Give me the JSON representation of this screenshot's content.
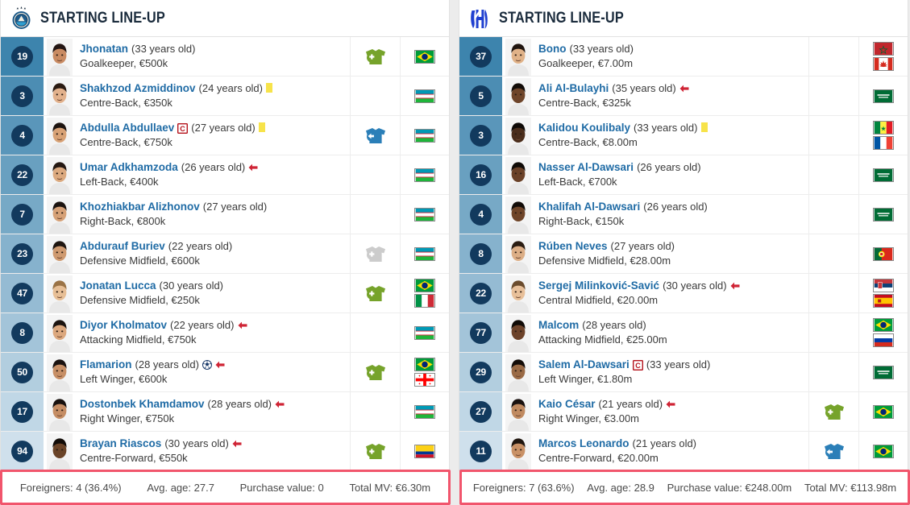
{
  "left": {
    "header": {
      "title": "STARTING LINE-UP",
      "crest_icon": "pakhtakor-crest-icon",
      "crest_colors": {
        "ring": "#1f5c8b",
        "field": "#2f9fd0"
      }
    },
    "players": [
      {
        "number": "19",
        "name": "Jhonatan",
        "age": "(33 years old)",
        "pos_value": "Goalkeeper, €500k",
        "marks": [],
        "sub": "sub-in-green",
        "flags": [
          "brazil"
        ],
        "skin": "#c98b63",
        "hair": "#231512"
      },
      {
        "number": "3",
        "name": "Shakhzod Azmiddinov",
        "age": "(24 years old)",
        "pos_value": "Centre-Back, €350k",
        "marks": [
          "yellow-card"
        ],
        "sub": "",
        "flags": [
          "uzbekistan"
        ],
        "skin": "#e2b18c",
        "hair": "#2a1a12"
      },
      {
        "number": "4",
        "name": "Abdulla Abdullaev",
        "age": "(27 years old)",
        "pos_value": "Centre-Back, €750k",
        "marks": [
          "captain",
          "yellow-card"
        ],
        "sub": "sub-out-blue",
        "flags": [
          "uzbekistan"
        ],
        "skin": "#d8a276",
        "hair": "#1d1410"
      },
      {
        "number": "22",
        "name": "Umar Adkhamzoda",
        "age": "(26 years old)",
        "pos_value": "Left-Back, €400k",
        "marks": [
          "sub-arrow-red"
        ],
        "sub": "",
        "flags": [
          "uzbekistan"
        ],
        "skin": "#dba97f",
        "hair": "#241812"
      },
      {
        "number": "7",
        "name": "Khozhiakbar Alizhonov",
        "age": "(27 years old)",
        "pos_value": "Right-Back, €800k",
        "marks": [],
        "sub": "",
        "flags": [
          "uzbekistan"
        ],
        "skin": "#d6a177",
        "hair": "#1b1310"
      },
      {
        "number": "23",
        "name": "Abdurauf Buriev",
        "age": "(22 years old)",
        "pos_value": "Defensive Midfield, €600k",
        "marks": [],
        "sub": "sub-in-grey",
        "flags": [
          "uzbekistan"
        ],
        "skin": "#cf9a70",
        "hair": "#1e1510"
      },
      {
        "number": "47",
        "name": "Jonatan Lucca",
        "age": "(30 years old)",
        "pos_value": "Defensive Midfield, €250k",
        "marks": [],
        "sub": "sub-in-green",
        "flags": [
          "brazil",
          "italy"
        ],
        "skin": "#e7bf96",
        "hair": "#9a7346"
      },
      {
        "number": "8",
        "name": "Diyor Kholmatov",
        "age": "(22 years old)",
        "pos_value": "Attacking Midfield, €750k",
        "marks": [
          "sub-arrow-red"
        ],
        "sub": "",
        "flags": [
          "uzbekistan"
        ],
        "skin": "#dca87e",
        "hair": "#1c1410"
      },
      {
        "number": "50",
        "name": "Flamarion",
        "age": "(28 years old)",
        "pos_value": "Left Winger, €600k",
        "marks": [
          "goal",
          "sub-arrow-red"
        ],
        "sub": "sub-in-green",
        "flags": [
          "brazil",
          "georgia"
        ],
        "skin": "#c78f66",
        "hair": "#1a1210"
      },
      {
        "number": "17",
        "name": "Dostonbek Khamdamov",
        "age": "(28 years old)",
        "pos_value": "Right Winger, €750k",
        "marks": [
          "sub-arrow-red"
        ],
        "sub": "",
        "flags": [
          "uzbekistan"
        ],
        "skin": "#c58d64",
        "hair": "#18110e"
      },
      {
        "number": "94",
        "name": "Brayan Riascos",
        "age": "(30 years old)",
        "pos_value": "Centre-Forward, €550k",
        "marks": [
          "sub-arrow-red"
        ],
        "sub": "sub-in-green",
        "flags": [
          "colombia"
        ],
        "skin": "#6b4428",
        "hair": "#120c08"
      }
    ],
    "footer": {
      "foreigners": "Foreigners: 4 (36.4%)",
      "avg_age": "Avg. age: 27.7",
      "purchase_value": "Purchase value: 0",
      "total_mv": "Total MV: €6.30m"
    }
  },
  "right": {
    "header": {
      "title": "STARTING LINE-UP",
      "crest_icon": "al-hilal-crest-icon",
      "crest_colors": {
        "main": "#1f3fd0"
      }
    },
    "players": [
      {
        "number": "37",
        "name": "Bono",
        "age": "(33 years old)",
        "pos_value": "Goalkeeper, €7.00m",
        "marks": [],
        "sub": "",
        "flags": [
          "morocco",
          "canada"
        ],
        "skin": "#e0b288",
        "hair": "#20150f"
      },
      {
        "number": "5",
        "name": "Ali Al-Bulayhi",
        "age": "(35 years old)",
        "pos_value": "Centre-Back, €325k",
        "marks": [
          "sub-arrow-red"
        ],
        "sub": "",
        "flags": [
          "saudi"
        ],
        "skin": "#6e452a",
        "hair": "#120c08"
      },
      {
        "number": "3",
        "name": "Kalidou Koulibaly",
        "age": "(33 years old)",
        "pos_value": "Centre-Back, €8.00m",
        "marks": [
          "yellow-card"
        ],
        "sub": "",
        "flags": [
          "senegal",
          "france"
        ],
        "skin": "#4a2d1b",
        "hair": "#0e0906"
      },
      {
        "number": "16",
        "name": "Nasser Al-Dawsari",
        "age": "(26 years old)",
        "pos_value": "Left-Back, €700k",
        "marks": [],
        "sub": "",
        "flags": [
          "saudi"
        ],
        "skin": "#6a4128",
        "hair": "#100b07"
      },
      {
        "number": "4",
        "name": "Khalifah Al-Dawsari",
        "age": "(26 years old)",
        "pos_value": "Right-Back, €150k",
        "marks": [],
        "sub": "",
        "flags": [
          "saudi"
        ],
        "skin": "#6f4529",
        "hair": "#120c08"
      },
      {
        "number": "8",
        "name": "Rúben Neves",
        "age": "(27 years old)",
        "pos_value": "Defensive Midfield, €28.00m",
        "marks": [],
        "sub": "",
        "flags": [
          "portugal"
        ],
        "skin": "#dcae86",
        "hair": "#2a1c12"
      },
      {
        "number": "22",
        "name": "Sergej Milinković-Savić",
        "age": "(30 years old)",
        "pos_value": "Central Midfield, €20.00m",
        "marks": [
          "sub-arrow-red"
        ],
        "sub": "",
        "flags": [
          "serbia",
          "spain"
        ],
        "skin": "#e8c09a",
        "hair": "#6b4c2e"
      },
      {
        "number": "77",
        "name": "Malcom",
        "age": "(28 years old)",
        "pos_value": "Attacking Midfield, €25.00m",
        "marks": [],
        "sub": "",
        "flags": [
          "brazil",
          "russia"
        ],
        "skin": "#6d432a",
        "hair": "#100b07"
      },
      {
        "number": "29",
        "name": "Salem Al-Dawsari",
        "age": "(33 years old)",
        "pos_value": "Left Winger, €1.80m",
        "marks": [
          "captain"
        ],
        "sub": "",
        "flags": [
          "saudi"
        ],
        "skin": "#9a6a45",
        "hair": "#140d09"
      },
      {
        "number": "27",
        "name": "Kaio César",
        "age": "(21 years old)",
        "pos_value": "Right Winger, €3.00m",
        "marks": [
          "sub-arrow-red"
        ],
        "sub": "sub-in-green",
        "flags": [
          "brazil"
        ],
        "skin": "#c08a60",
        "hair": "#1a1210"
      },
      {
        "number": "11",
        "name": "Marcos Leonardo",
        "age": "(21 years old)",
        "pos_value": "Centre-Forward, €20.00m",
        "marks": [],
        "sub": "sub-out-blue",
        "flags": [
          "brazil"
        ],
        "skin": "#c99166",
        "hair": "#20160f"
      }
    ],
    "footer": {
      "foreigners": "Foreigners: 7 (63.6%)",
      "avg_age": "Avg. age: 28.9",
      "purchase_value": "Purchase value: €248.00m",
      "total_mv": "Total MV: €113.98m"
    }
  },
  "colors": {
    "name_link": "#1f6ba5",
    "badge_bg": "#123a5e",
    "num_col_top": "#3d84ad",
    "num_col_bottom": "#cfe0ec",
    "sub_in": "#76a32b",
    "sub_out": "#2b7fb8",
    "sub_disabled": "#cccccc",
    "highlight_border": "#f1556c",
    "yellow_card": "#f7e34a",
    "red_arrow": "#cf2435"
  }
}
